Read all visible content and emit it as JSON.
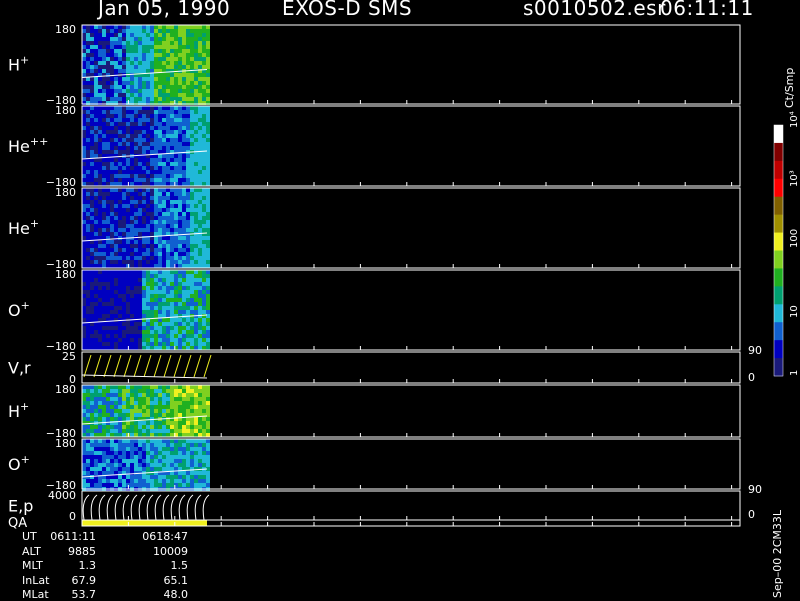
{
  "header": {
    "date": "Jan 05, 1990",
    "mission": "EXOS-D SMS",
    "file": "s0010502.esr",
    "time": "06:11:11"
  },
  "side_labels": {
    "units": "Ct/Smp",
    "version": "Sep–00 2CM33L"
  },
  "colors": {
    "background": "#000000",
    "axis": "#ffffff",
    "scale": [
      "#1a1a7a",
      "#0000c0",
      "#1060d0",
      "#20b8d8",
      "#00a070",
      "#20b020",
      "#80d020",
      "#f0f020",
      "#a09000",
      "#806000",
      "#ff0000",
      "#c00000",
      "#800000",
      "#ffffff"
    ]
  },
  "chart_data": [
    {
      "type": "heatmap",
      "panel": "H+",
      "label_base": "H",
      "label_sup": "+",
      "ylim": [
        -180,
        180
      ],
      "tick_top": "180",
      "tick_bottom": "−180"
    },
    {
      "type": "heatmap",
      "panel": "He++",
      "label_base": "He",
      "label_sup": "++",
      "ylim": [
        -180,
        180
      ],
      "tick_top": "180",
      "tick_bottom": "−180"
    },
    {
      "type": "heatmap",
      "panel": "He+",
      "label_base": "He",
      "label_sup": "+",
      "ylim": [
        -180,
        180
      ],
      "tick_top": "180",
      "tick_bottom": "−180"
    },
    {
      "type": "heatmap",
      "panel": "O+",
      "label_base": "O",
      "label_sup": "+",
      "ylim": [
        -180,
        180
      ],
      "tick_top": "180",
      "tick_bottom": "−180"
    },
    {
      "type": "line",
      "panel": "V,r",
      "label_base": "V,r",
      "label_sup": "",
      "ylim": [
        0,
        25
      ],
      "tick_top": "25",
      "tick_bottom": "0",
      "right_top": "90",
      "right_bottom": "0"
    },
    {
      "type": "heatmap",
      "panel": "H+ (2)",
      "label_base": "H",
      "label_sup": "+",
      "ylim": [
        -180,
        180
      ],
      "tick_top": "180",
      "tick_bottom": "−180"
    },
    {
      "type": "heatmap",
      "panel": "O+ (2)",
      "label_base": "O",
      "label_sup": "+",
      "ylim": [
        -180,
        180
      ],
      "tick_top": "180",
      "tick_bottom": "−180"
    },
    {
      "type": "line",
      "panel": "E,p",
      "label_base": "E,p",
      "label_sup": "",
      "ylim": [
        0,
        4000
      ],
      "tick_top": "4000",
      "tick_bottom": "0",
      "right_top": "90",
      "right_bottom": "0"
    },
    {
      "type": "bar",
      "panel": "QA",
      "label_base": "QA",
      "label_sup": ""
    }
  ],
  "colorbar": {
    "label": "Ct/Smp",
    "ticks": [
      "1",
      "10",
      "100",
      "10³",
      "10⁴"
    ]
  },
  "ephemeris": {
    "rows": [
      {
        "label": "UT",
        "v1": "0611:11",
        "v2": "0618:47"
      },
      {
        "label": "ALT",
        "v1": "9885",
        "v2": "10009"
      },
      {
        "label": "MLT",
        "v1": "1.3",
        "v2": "1.5"
      },
      {
        "label": "InLat",
        "v1": "67.9",
        "v2": "65.1"
      },
      {
        "label": "MLat",
        "v1": "53.7",
        "v2": "48.0"
      }
    ]
  }
}
